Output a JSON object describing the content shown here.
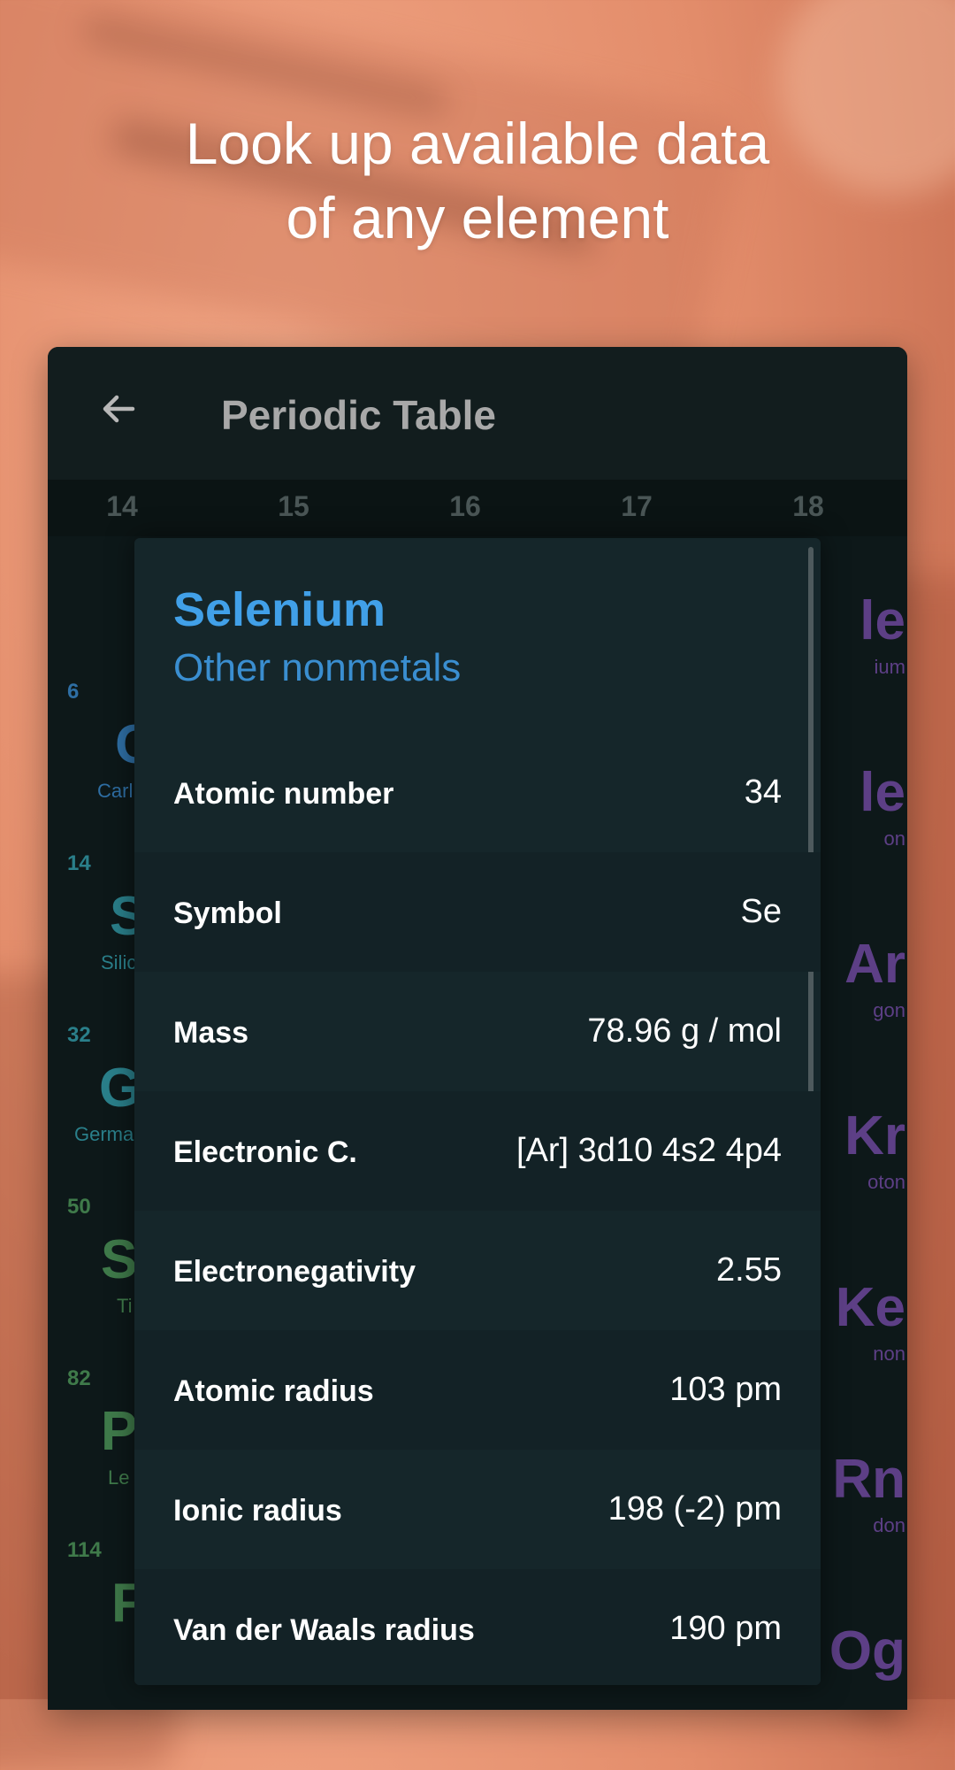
{
  "headline": {
    "line1": "Look up available data",
    "line2": "of any element"
  },
  "app": {
    "title": "Periodic Table"
  },
  "group_numbers": [
    "14",
    "15",
    "16",
    "17",
    "18"
  ],
  "left_column": [
    {
      "number": "",
      "symbol": "",
      "name": ""
    },
    {
      "number": "6",
      "symbol": "C",
      "name": "Carl",
      "color": "#2e6ea3"
    },
    {
      "number": "14",
      "symbol": "S",
      "name": "Silic",
      "color": "#2a7f8a"
    },
    {
      "number": "32",
      "symbol": "G",
      "name": "Germa",
      "color": "#2a7f8a"
    },
    {
      "number": "50",
      "symbol": "S",
      "name": "Ti",
      "color": "#3f7a4a"
    },
    {
      "number": "82",
      "symbol": "P",
      "name": "Le",
      "color": "#3f7a4a"
    },
    {
      "number": "114",
      "symbol": "F",
      "name": "",
      "color": "#3f7a4a"
    }
  ],
  "right_column": [
    {
      "symbol": "le",
      "name": "ium",
      "color": "#5d3f86"
    },
    {
      "symbol": "le",
      "name": "on",
      "color": "#5d3f86"
    },
    {
      "symbol": "Ar",
      "name": "gon",
      "color": "#5d3f86"
    },
    {
      "symbol": "Kr",
      "name": "oton",
      "color": "#5d3f86"
    },
    {
      "symbol": "Ke",
      "name": "non",
      "color": "#5d3f86"
    },
    {
      "symbol": "Rn",
      "name": "don",
      "color": "#5d3f86"
    },
    {
      "symbol": "Og",
      "name": "",
      "color": "#5d3f86"
    }
  ],
  "element": {
    "name": "Selenium",
    "category": "Other nonmetals",
    "properties": [
      {
        "label": "Atomic number",
        "value": "34"
      },
      {
        "label": "Symbol",
        "value": "Se"
      },
      {
        "label": "Mass",
        "value": "78.96 g / mol"
      },
      {
        "label": "Electronic C.",
        "value": "[Ar] 3d10 4s2 4p4"
      },
      {
        "label": "Electronegativity",
        "value": "2.55"
      },
      {
        "label": "Atomic radius",
        "value": "103 pm"
      },
      {
        "label": "Ionic radius",
        "value": "198 (-2) pm"
      },
      {
        "label": "Van der Waals radius",
        "value": "190 pm"
      }
    ]
  },
  "icons": {
    "back": "arrow-left-icon"
  }
}
